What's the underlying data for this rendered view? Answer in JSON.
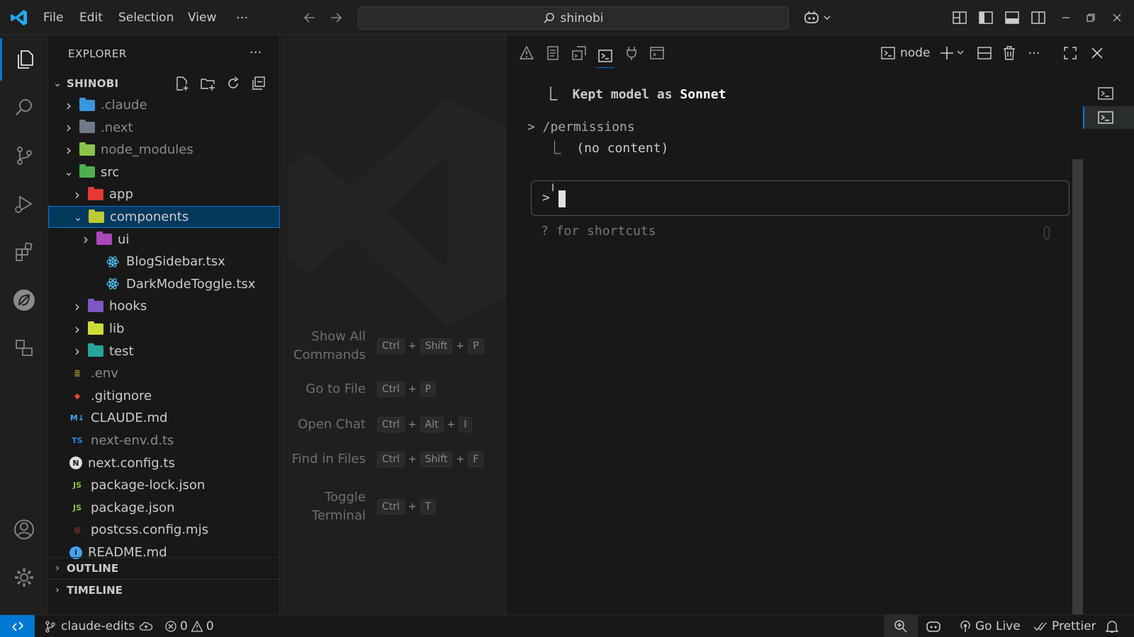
{
  "titlebar": {
    "menu": [
      "File",
      "Edit",
      "Selection",
      "View",
      "···"
    ],
    "search": "shinobi"
  },
  "explorer": {
    "title": "EXPLORER",
    "more": "···",
    "project": "SHINOBI",
    "tree": [
      {
        "name": ".claude",
        "kind": "folder",
        "depth": 0,
        "open": false,
        "color": "#3a96dd",
        "dim": true
      },
      {
        "name": ".next",
        "kind": "folder",
        "depth": 0,
        "open": false,
        "color": "#6c7a89",
        "dim": true
      },
      {
        "name": "node_modules",
        "kind": "folder",
        "depth": 0,
        "open": false,
        "color": "#8bc34a",
        "dim": true
      },
      {
        "name": "src",
        "kind": "folder",
        "depth": 0,
        "open": true,
        "color": "#4caf50",
        "dim": false
      },
      {
        "name": "app",
        "kind": "folder",
        "depth": 1,
        "open": false,
        "color": "#e53935",
        "dim": false
      },
      {
        "name": "components",
        "kind": "folder",
        "depth": 1,
        "open": true,
        "color": "#c0ca33",
        "dim": false,
        "selected": true
      },
      {
        "name": "ui",
        "kind": "folder",
        "depth": 2,
        "open": false,
        "color": "#ab47bc",
        "dim": false
      },
      {
        "name": "BlogSidebar.tsx",
        "kind": "react",
        "depth": 3,
        "color": "#4fc3f7",
        "dim": false
      },
      {
        "name": "DarkModeToggle.tsx",
        "kind": "react",
        "depth": 3,
        "color": "#4fc3f7",
        "dim": false
      },
      {
        "name": "hooks",
        "kind": "folder",
        "depth": 1,
        "open": false,
        "color": "#7e57c2",
        "dim": false
      },
      {
        "name": "lib",
        "kind": "folder",
        "depth": 1,
        "open": false,
        "color": "#cddc39",
        "dim": false
      },
      {
        "name": "test",
        "kind": "folder",
        "depth": 1,
        "open": false,
        "color": "#26a69a",
        "dim": false
      },
      {
        "name": ".env",
        "kind": "env",
        "depth": 0,
        "color": "#c9a227",
        "dim": true,
        "glyph": "≣"
      },
      {
        "name": ".gitignore",
        "kind": "git",
        "depth": 0,
        "color": "#e64a19",
        "dim": false,
        "glyph": "◆"
      },
      {
        "name": "CLAUDE.md",
        "kind": "md",
        "depth": 0,
        "color": "#42a5f5",
        "dim": false,
        "glyph": "M↓"
      },
      {
        "name": "next-env.d.ts",
        "kind": "ts",
        "depth": 0,
        "color": "#1e88e5",
        "dim": true,
        "glyph": "TS"
      },
      {
        "name": "next.config.ts",
        "kind": "next",
        "depth": 0,
        "color": "#e0e0e0",
        "dim": false,
        "glyph": "N"
      },
      {
        "name": "package-lock.json",
        "kind": "node",
        "depth": 0,
        "color": "#8bc34a",
        "dim": false,
        "glyph": "JS"
      },
      {
        "name": "package.json",
        "kind": "node",
        "depth": 0,
        "color": "#8bc34a",
        "dim": false,
        "glyph": "JS"
      },
      {
        "name": "postcss.config.mjs",
        "kind": "postcss",
        "depth": 0,
        "color": "#e53935",
        "dim": false,
        "glyph": "◎"
      },
      {
        "name": "README.md",
        "kind": "info",
        "depth": 0,
        "color": "#42a5f5",
        "dim": false,
        "glyph": "i"
      }
    ],
    "outline": "OUTLINE",
    "timeline": "TIMELINE"
  },
  "welcome": {
    "shortcuts": [
      {
        "label": "Show All Commands",
        "keys": [
          "Ctrl",
          "Shift",
          "P"
        ]
      },
      {
        "label": "Go to File",
        "keys": [
          "Ctrl",
          "P"
        ]
      },
      {
        "label": "Open Chat",
        "keys": [
          "Ctrl",
          "Alt",
          "I"
        ]
      },
      {
        "label": "Find in Files",
        "keys": [
          "Ctrl",
          "Shift",
          "F"
        ]
      },
      {
        "label": "Toggle Terminal",
        "keys": [
          "Ctrl",
          "T"
        ]
      }
    ],
    "plus": "+"
  },
  "panel": {
    "terminal_name": "node",
    "lines": {
      "kept_prefix": "⎿  Kept model as ",
      "kept_model": "Sonnet",
      "perm_cmd": "> /permissions",
      "perm_result": "  ⎿  (no content)",
      "prompt": ">",
      "hint": "? for shortcuts"
    }
  },
  "statusbar": {
    "branch": "claude-edits",
    "errors": "0",
    "warnings": "0",
    "go_live": "Go Live",
    "prettier": "Prettier"
  },
  "colors": {
    "accent": "#0078d4",
    "selection_bg": "#04395e",
    "remote_bg": "#0078d4"
  }
}
